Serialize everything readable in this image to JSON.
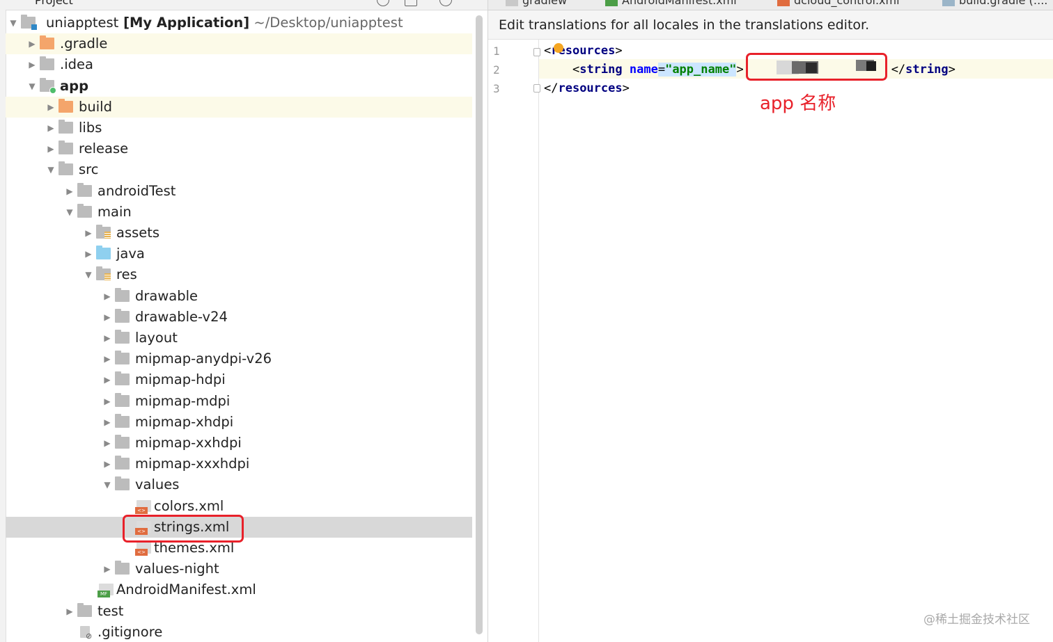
{
  "project_panel": {
    "title": "Project",
    "tree": [
      {
        "label": "uniapptest",
        "bold": "[My Application]",
        "path": "~/Desktop/uniapptest",
        "arrow": "down",
        "icon": "folder-module-icon",
        "indent": 0
      },
      {
        "label": ".gradle",
        "arrow": "right",
        "icon": "folder-orange-icon",
        "indent": 1,
        "highlight": true
      },
      {
        "label": ".idea",
        "arrow": "right",
        "icon": "folder-icon",
        "indent": 1
      },
      {
        "label": "app",
        "arrow": "down",
        "icon": "folder-module-app-icon",
        "indent": 1,
        "bold_label": true
      },
      {
        "label": "build",
        "arrow": "right",
        "icon": "folder-orange-icon",
        "indent": 2,
        "highlight": true
      },
      {
        "label": "libs",
        "arrow": "right",
        "icon": "folder-icon",
        "indent": 2
      },
      {
        "label": "release",
        "arrow": "right",
        "icon": "folder-icon",
        "indent": 2
      },
      {
        "label": "src",
        "arrow": "down",
        "icon": "folder-icon",
        "indent": 2
      },
      {
        "label": "androidTest",
        "arrow": "right",
        "icon": "folder-icon",
        "indent": 3
      },
      {
        "label": "main",
        "arrow": "down",
        "icon": "folder-icon",
        "indent": 3
      },
      {
        "label": "assets",
        "arrow": "right",
        "icon": "folder-resources-icon",
        "indent": 4
      },
      {
        "label": "java",
        "arrow": "right",
        "icon": "folder-source-icon",
        "indent": 4
      },
      {
        "label": "res",
        "arrow": "down",
        "icon": "folder-resources-icon",
        "indent": 4
      },
      {
        "label": "drawable",
        "arrow": "right",
        "icon": "folder-icon",
        "indent": 5
      },
      {
        "label": "drawable-v24",
        "arrow": "right",
        "icon": "folder-icon",
        "indent": 5
      },
      {
        "label": "layout",
        "arrow": "right",
        "icon": "folder-icon",
        "indent": 5
      },
      {
        "label": "mipmap-anydpi-v26",
        "arrow": "right",
        "icon": "folder-icon",
        "indent": 5
      },
      {
        "label": "mipmap-hdpi",
        "arrow": "right",
        "icon": "folder-icon",
        "indent": 5
      },
      {
        "label": "mipmap-mdpi",
        "arrow": "right",
        "icon": "folder-icon",
        "indent": 5
      },
      {
        "label": "mipmap-xhdpi",
        "arrow": "right",
        "icon": "folder-icon",
        "indent": 5
      },
      {
        "label": "mipmap-xxhdpi",
        "arrow": "right",
        "icon": "folder-icon",
        "indent": 5
      },
      {
        "label": "mipmap-xxxhdpi",
        "arrow": "right",
        "icon": "folder-icon",
        "indent": 5
      },
      {
        "label": "values",
        "arrow": "down",
        "icon": "folder-icon",
        "indent": 5
      },
      {
        "label": "colors.xml",
        "arrow": "",
        "icon": "xml-file-icon",
        "indent": 6
      },
      {
        "label": "strings.xml",
        "arrow": "",
        "icon": "xml-file-icon",
        "indent": 6,
        "selected": true
      },
      {
        "label": "themes.xml",
        "arrow": "",
        "icon": "xml-file-icon",
        "indent": 6
      },
      {
        "label": "values-night",
        "arrow": "right",
        "icon": "folder-icon",
        "indent": 5
      },
      {
        "label": "AndroidManifest.xml",
        "arrow": "",
        "icon": "manifest-file-icon",
        "indent": 4
      },
      {
        "label": "test",
        "arrow": "right",
        "icon": "folder-icon",
        "indent": 3
      },
      {
        "label": ".gitignore",
        "arrow": "",
        "icon": "gitignore-file-icon",
        "indent": 3
      }
    ]
  },
  "editor": {
    "tabs": [
      {
        "label": "gradlew",
        "icon": "file-icon"
      },
      {
        "label": "AndroidManifest.xml",
        "icon": "manifest-file-icon"
      },
      {
        "label": "dcloud_control.xml",
        "icon": "xml-file-icon"
      },
      {
        "label": "build.gradle (:...",
        "icon": "gradle-icon"
      }
    ],
    "notice": "Edit translations for all locales in the translations editor.",
    "line_numbers": [
      "1",
      "2",
      "3"
    ],
    "lines": {
      "l1_open": "<",
      "l1_tag": "resources",
      "l1_close": ">",
      "l2_indent": "    ",
      "l2_open": "<",
      "l2_tag": "string",
      "l2_attr": "name",
      "l2_eq": "=",
      "l2_val": "\"app_name\"",
      "l2_gt": ">",
      "l2_end_open": "</",
      "l2_end_tag": "string",
      "l2_end_close": ">",
      "l3_open": "</",
      "l3_tag": "resources",
      "l3_close": ">"
    },
    "annotation": "app 名称"
  },
  "watermark": "@稀土掘金技术社区",
  "colors": {
    "annotation_red": "#e8212a",
    "selection_gray": "#d8d8d8",
    "highlight_yellow": "#fcfae8",
    "xml_tag": "#000080",
    "xml_attr": "#0000ff",
    "xml_string": "#008000"
  }
}
